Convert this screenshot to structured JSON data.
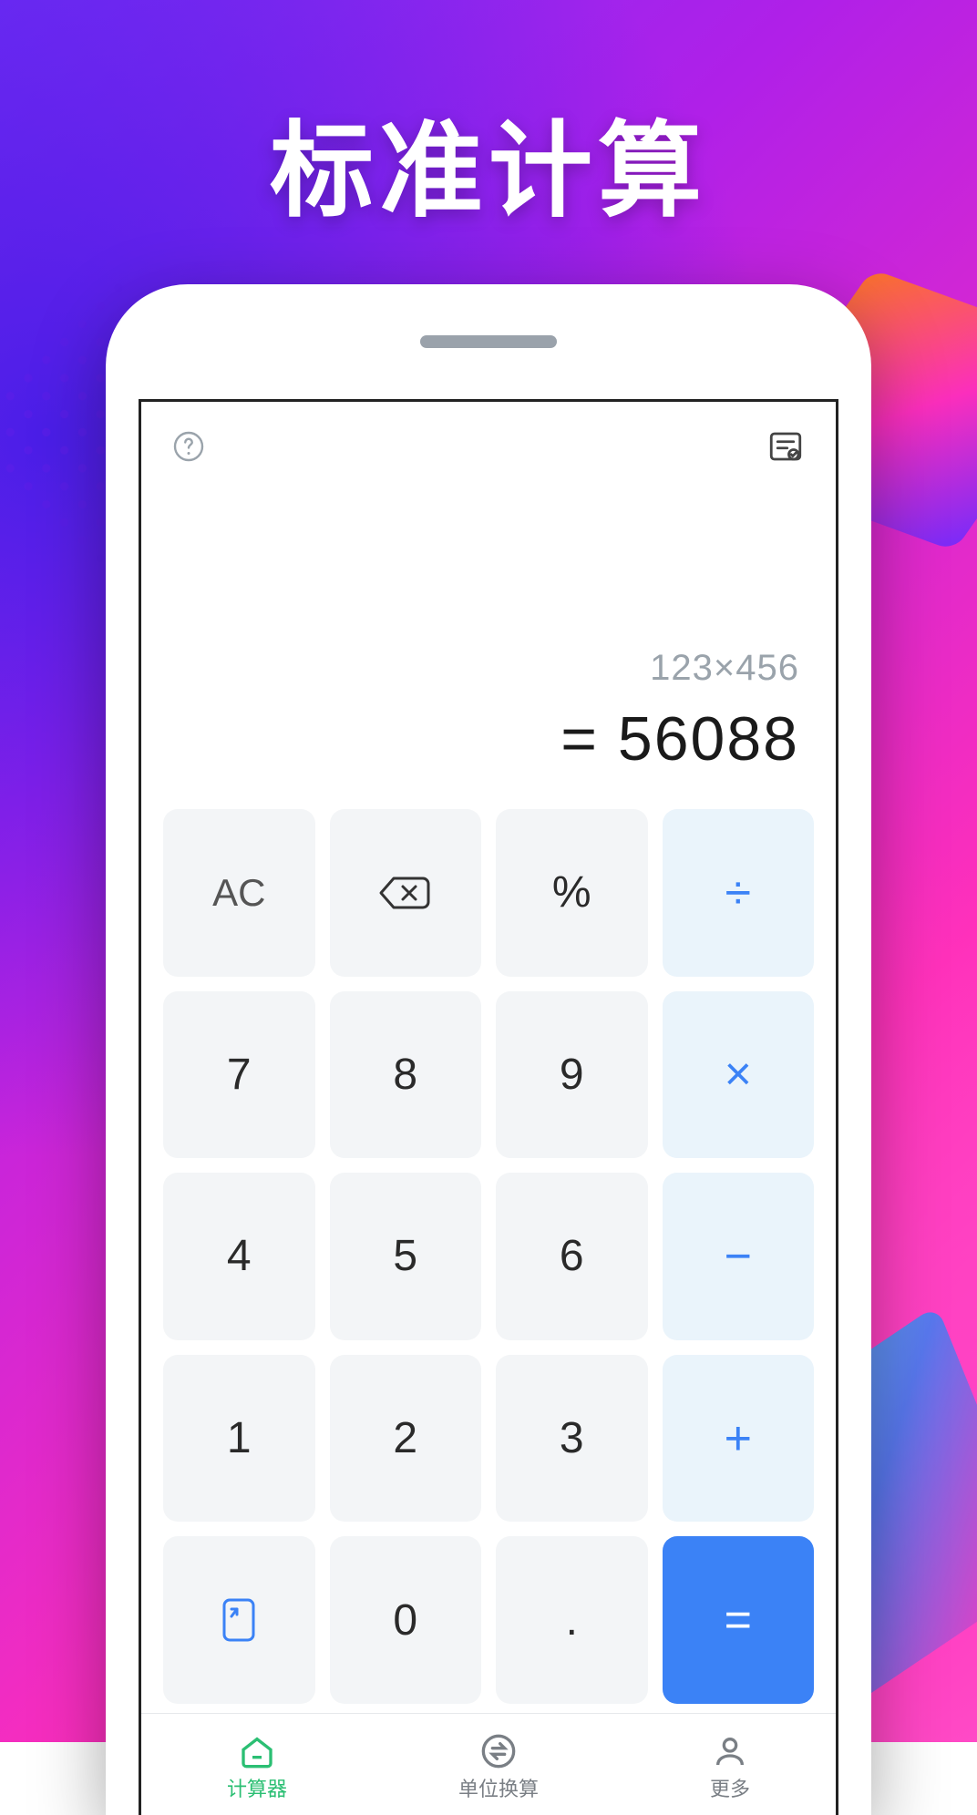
{
  "hero_title": "标准计算",
  "display": {
    "expression": "123×456",
    "result": "= 56088"
  },
  "keys": {
    "ac": "AC",
    "percent": "%",
    "divide": "÷",
    "seven": "7",
    "eight": "8",
    "nine": "9",
    "multiply": "×",
    "four": "4",
    "five": "5",
    "six": "6",
    "minus": "−",
    "one": "1",
    "two": "2",
    "three": "3",
    "plus": "+",
    "zero": "0",
    "dot": ".",
    "equals": "="
  },
  "nav": {
    "calculator": "计算器",
    "unit": "单位换算",
    "more": "更多"
  },
  "icons": {
    "help": "help-icon",
    "history": "history-icon",
    "backspace": "backspace-icon",
    "expand": "expand-icon"
  }
}
